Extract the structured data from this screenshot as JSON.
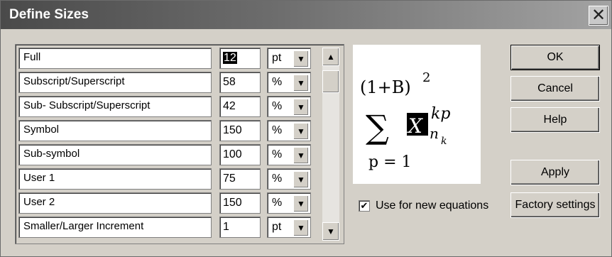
{
  "window": {
    "title": "Define Sizes",
    "close_glyph": "✕"
  },
  "rows": [
    {
      "label": "Full",
      "value": "12",
      "unit": "pt",
      "selected": true
    },
    {
      "label": "Subscript/Superscript",
      "value": "58",
      "unit": "%"
    },
    {
      "label": "Sub- Subscript/Superscript",
      "value": "42",
      "unit": "%"
    },
    {
      "label": "Symbol",
      "value": "150",
      "unit": "%"
    },
    {
      "label": "Sub-symbol",
      "value": "100",
      "unit": "%"
    },
    {
      "label": "User 1",
      "value": "75",
      "unit": "%"
    },
    {
      "label": "User 2",
      "value": "150",
      "unit": "%"
    },
    {
      "label": "Smaller/Larger Increment",
      "value": "1",
      "unit": "pt"
    }
  ],
  "preview": {
    "paren_expr": "(1+B)",
    "exp": "2",
    "sigma": "∑",
    "var": "X",
    "sup": "kp",
    "sub": "n",
    "subsub": "k",
    "lower": "p = 1"
  },
  "options": {
    "use_new_label": "Use for new equations",
    "checked": true
  },
  "buttons": {
    "ok": "OK",
    "cancel": "Cancel",
    "help": "Help",
    "apply": "Apply",
    "factory": "Factory settings"
  }
}
